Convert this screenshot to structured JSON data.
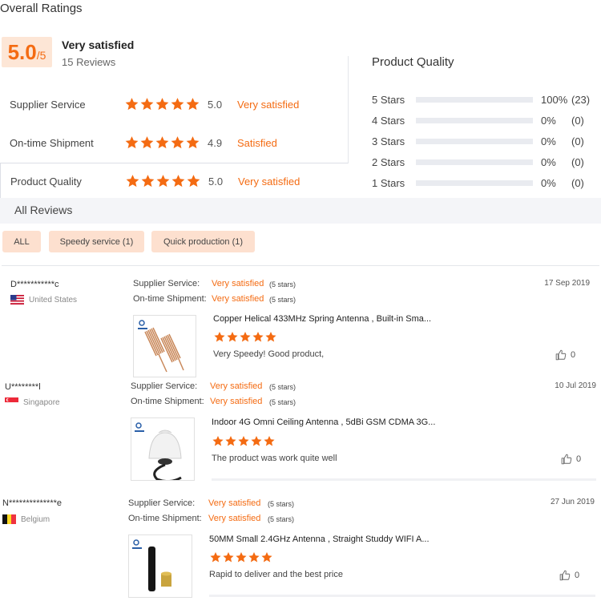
{
  "overall": {
    "title": "Overall Ratings",
    "score": "5.0",
    "score_max": "/5",
    "summary_label": "Very satisfied",
    "review_count": "15 Reviews"
  },
  "ratings": [
    {
      "label": "Supplier Service",
      "value": "5.0",
      "text": "Very satisfied",
      "stars": 5
    },
    {
      "label": "On-time Shipment",
      "value": "4.9",
      "text": "Satisfied",
      "stars": 5
    },
    {
      "label": "Product Quality",
      "value": "5.0",
      "text": "Very satisfied",
      "stars": 5
    }
  ],
  "product_quality": {
    "title": "Product Quality",
    "rows": [
      {
        "label": "5 Stars",
        "percent": "100%",
        "count": "(23)",
        "fraction": 1.0
      },
      {
        "label": "4 Stars",
        "percent": "0%",
        "count": "(0)",
        "fraction": 0
      },
      {
        "label": "3 Stars",
        "percent": "0%",
        "count": "(0)",
        "fraction": 0
      },
      {
        "label": "2 Stars",
        "percent": "0%",
        "count": "(0)",
        "fraction": 0
      },
      {
        "label": "1 Stars",
        "percent": "0%",
        "count": "(0)",
        "fraction": 0
      }
    ]
  },
  "all_reviews": {
    "title": "All Reviews",
    "filters": [
      "ALL",
      "Speedy service (1)",
      "Quick production (1)"
    ]
  },
  "labels": {
    "supplier_service": "Supplier Service:",
    "on_time_shipment": "On-time Shipment:"
  },
  "reviews": [
    {
      "reviewer": "D***********c",
      "country": "United States",
      "supplier_service": "Very satisfied",
      "supplier_stars": "(5 stars)",
      "shipment": "Very satisfied",
      "shipment_stars": "(5 stars)",
      "date": "17 Sep 2019",
      "product_title": "Copper Helical 433MHz Spring Antenna , Built-in Sma...",
      "product_stars": 5,
      "comment": "Very Speedy! Good product,",
      "likes": "0"
    },
    {
      "reviewer": "U********l",
      "country": "Singapore",
      "supplier_service": "Very satisfied",
      "supplier_stars": "(5 stars)",
      "shipment": "Very satisfied",
      "shipment_stars": "(5 stars)",
      "date": "10 Jul 2019",
      "product_title": "Indoor 4G Omni Ceiling Antenna , 5dBi GSM CDMA 3G...",
      "product_stars": 5,
      "comment": "The product was work quite well",
      "likes": "0"
    },
    {
      "reviewer": "N**************e",
      "country": "Belgium",
      "supplier_service": "Very satisfied",
      "supplier_stars": "(5 stars)",
      "shipment": "Very satisfied",
      "shipment_stars": "(5 stars)",
      "date": "27 Jun 2019",
      "product_title": "50MM Small 2.4GHz Antenna , Straight Studdy WIFI A...",
      "product_stars": 5,
      "comment": "Rapid to deliver and the best price",
      "likes": "0"
    }
  ],
  "colors": {
    "accent": "#f46b12",
    "chip_bg": "#fde0cf",
    "score_bg": "#fde6d6"
  },
  "icons": {
    "star": "star-icon",
    "like": "thumbs-up-icon",
    "flags": [
      "flag-us-icon",
      "flag-sg-icon",
      "flag-be-icon"
    ]
  }
}
